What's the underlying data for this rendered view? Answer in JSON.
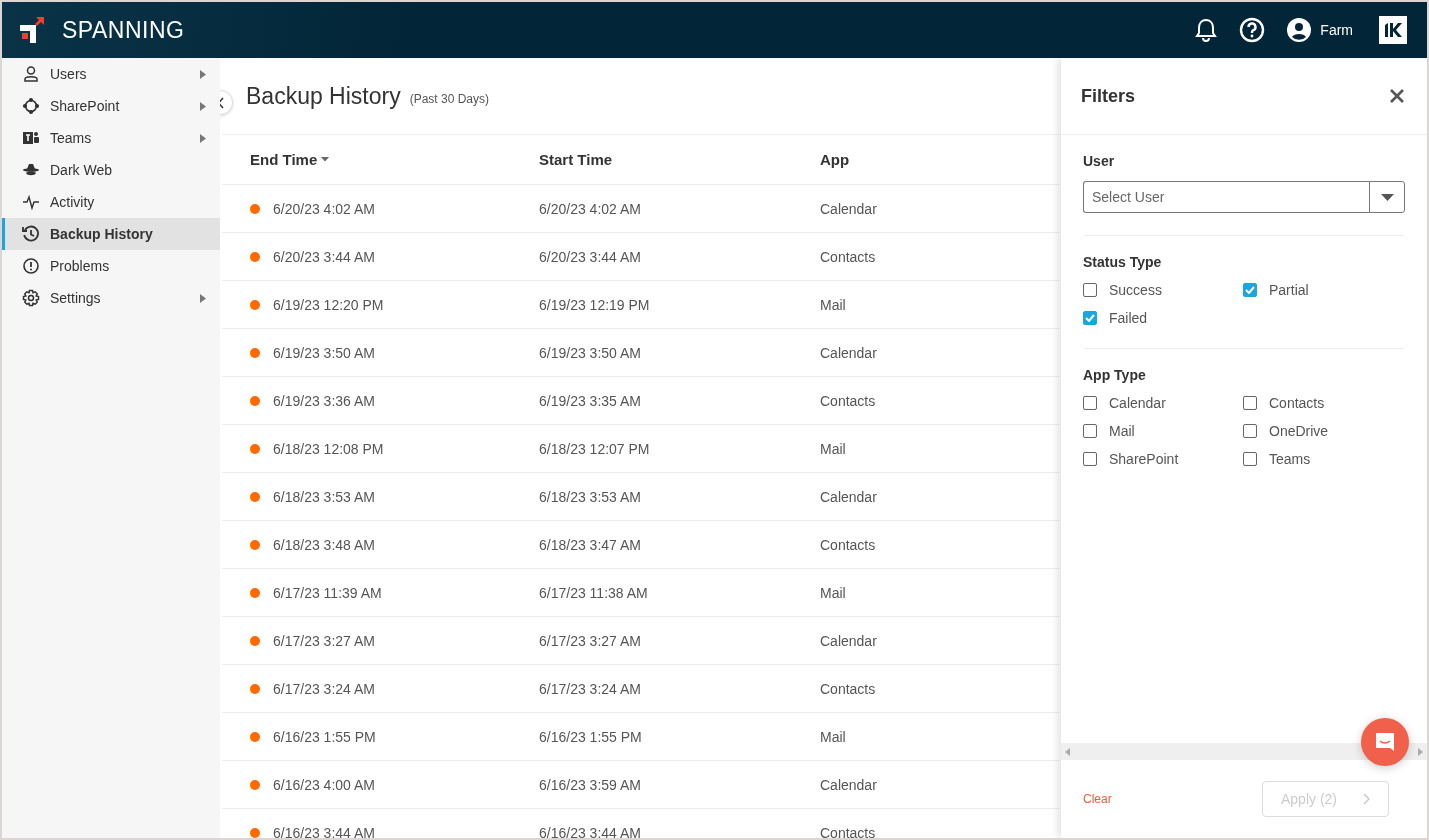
{
  "header": {
    "brand": "SPANNING",
    "user": "Farm"
  },
  "sidebar": {
    "items": [
      {
        "label": "Users",
        "has_submenu": true,
        "selected": false
      },
      {
        "label": "SharePoint",
        "has_submenu": true,
        "selected": false
      },
      {
        "label": "Teams",
        "has_submenu": true,
        "selected": false
      },
      {
        "label": "Dark Web",
        "has_submenu": false,
        "selected": false
      },
      {
        "label": "Activity",
        "has_submenu": false,
        "selected": false
      },
      {
        "label": "Backup History",
        "has_submenu": false,
        "selected": true
      },
      {
        "label": "Problems",
        "has_submenu": false,
        "selected": false
      },
      {
        "label": "Settings",
        "has_submenu": true,
        "selected": false
      }
    ]
  },
  "page": {
    "title": "Backup History",
    "subtitle": "(Past 30 Days)"
  },
  "table": {
    "columns": [
      {
        "label": "End Time",
        "sorted": true
      },
      {
        "label": "Start Time",
        "sorted": false
      },
      {
        "label": "App",
        "sorted": false
      }
    ],
    "rows": [
      {
        "color": "#ff6a00",
        "end": "6/20/23 4:02 AM",
        "start": "6/20/23 4:02 AM",
        "app": "Calendar"
      },
      {
        "color": "#ff6a00",
        "end": "6/20/23 3:44 AM",
        "start": "6/20/23 3:44 AM",
        "app": "Contacts"
      },
      {
        "color": "#ff6a00",
        "end": "6/19/23 12:20 PM",
        "start": "6/19/23 12:19 PM",
        "app": "Mail"
      },
      {
        "color": "#ff6a00",
        "end": "6/19/23 3:50 AM",
        "start": "6/19/23 3:50 AM",
        "app": "Calendar"
      },
      {
        "color": "#ff6a00",
        "end": "6/19/23 3:36 AM",
        "start": "6/19/23 3:35 AM",
        "app": "Contacts"
      },
      {
        "color": "#ff6a00",
        "end": "6/18/23 12:08 PM",
        "start": "6/18/23 12:07 PM",
        "app": "Mail"
      },
      {
        "color": "#ff6a00",
        "end": "6/18/23 3:53 AM",
        "start": "6/18/23 3:53 AM",
        "app": "Calendar"
      },
      {
        "color": "#ff6a00",
        "end": "6/18/23 3:48 AM",
        "start": "6/18/23 3:47 AM",
        "app": "Contacts"
      },
      {
        "color": "#ff6a00",
        "end": "6/17/23 11:39 AM",
        "start": "6/17/23 11:38 AM",
        "app": "Mail"
      },
      {
        "color": "#ff6a00",
        "end": "6/17/23 3:27 AM",
        "start": "6/17/23 3:27 AM",
        "app": "Calendar"
      },
      {
        "color": "#ff6a00",
        "end": "6/17/23 3:24 AM",
        "start": "6/17/23 3:24 AM",
        "app": "Contacts"
      },
      {
        "color": "#ff6a00",
        "end": "6/16/23 1:55 PM",
        "start": "6/16/23 1:55 PM",
        "app": "Mail"
      },
      {
        "color": "#ff6a00",
        "end": "6/16/23 4:00 AM",
        "start": "6/16/23 3:59 AM",
        "app": "Calendar"
      },
      {
        "color": "#ff6a00",
        "end": "6/16/23 3:44 AM",
        "start": "6/16/23 3:44 AM",
        "app": "Contacts"
      }
    ]
  },
  "filters": {
    "title": "Filters",
    "user_label": "User",
    "user_placeholder": "Select User",
    "status_label": "Status Type",
    "status_options": [
      {
        "label": "Success",
        "checked": false
      },
      {
        "label": "Partial",
        "checked": true
      },
      {
        "label": "Failed",
        "checked": true
      }
    ],
    "app_label": "App Type",
    "app_options": [
      {
        "label": "Calendar",
        "checked": false
      },
      {
        "label": "Contacts",
        "checked": false
      },
      {
        "label": "Mail",
        "checked": false
      },
      {
        "label": "OneDrive",
        "checked": false
      },
      {
        "label": "SharePoint",
        "checked": false
      },
      {
        "label": "Teams",
        "checked": false
      }
    ],
    "clear": "Clear",
    "apply": {
      "label": "Apply (2)",
      "disabled": true
    }
  }
}
